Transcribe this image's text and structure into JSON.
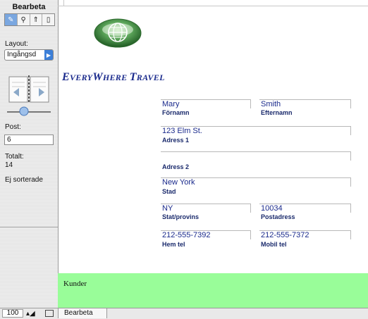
{
  "status_area": {
    "mode_title": "Bearbeta",
    "tools": [
      {
        "icon": "pencil-browse-icon"
      },
      {
        "icon": "find-icon"
      },
      {
        "icon": "layout-icon"
      },
      {
        "icon": "preview-icon"
      }
    ],
    "layout_label": "Layout:",
    "layout_value": "Ingångsd",
    "record_label": "Post:",
    "record_value": "6",
    "total_label": "Totalt:",
    "total_value": "14",
    "sort_status": "Ej sorterade"
  },
  "content": {
    "logo": "globe-logo",
    "company_name": {
      "parts": [
        {
          "text": "E",
          "size": "big"
        },
        {
          "text": "VERY",
          "size": "small"
        },
        {
          "text": "W",
          "size": "big"
        },
        {
          "text": "HERE ",
          "size": "small"
        },
        {
          "text": "T",
          "size": "big"
        },
        {
          "text": "RAVEL",
          "size": "small"
        }
      ]
    },
    "fields": {
      "first_name": {
        "value": "Mary",
        "label": "Förnamn"
      },
      "last_name": {
        "value": "Smith",
        "label": "Efternamn"
      },
      "address1": {
        "value": "123 Elm St.",
        "label": "Adress 1"
      },
      "address2": {
        "value": "",
        "label": "Adress 2"
      },
      "city": {
        "value": "New York",
        "label": "Stad"
      },
      "state": {
        "value": "NY",
        "label": "Stat/provins"
      },
      "zip": {
        "value": "10034",
        "label": "Postadress"
      },
      "home_phone": {
        "value": "212-555-7392",
        "label": "Hem tel"
      },
      "mobile_phone": {
        "value": "212-555-7372",
        "label": "Mobil tel"
      }
    },
    "footer_label": "Kunder",
    "footer_color": "#99fd99",
    "text_color": "#1a2a8c"
  },
  "bottom_bar": {
    "zoom": "100",
    "mode_status": "Bearbeta"
  }
}
